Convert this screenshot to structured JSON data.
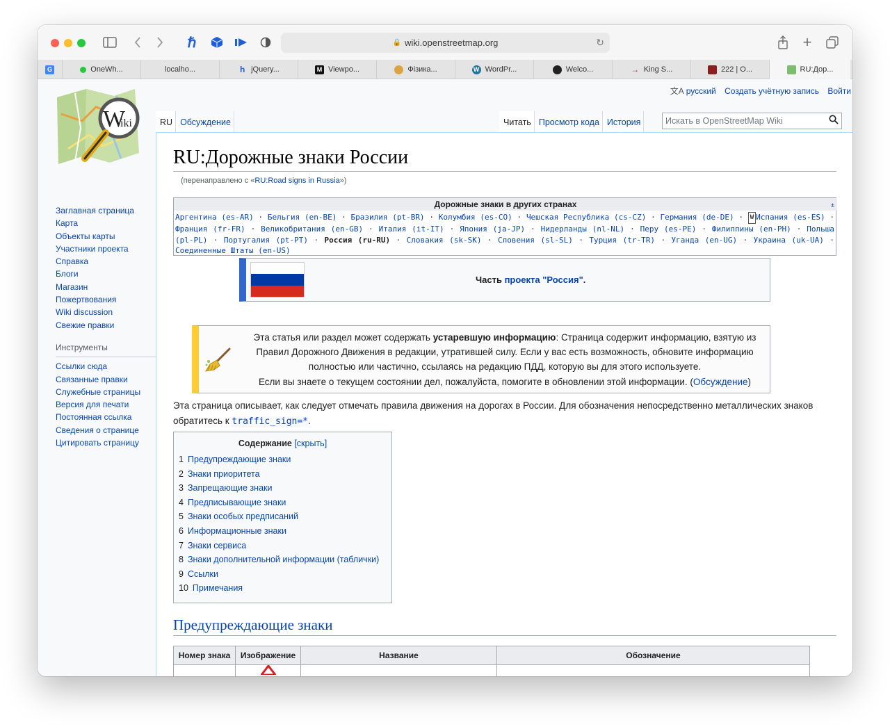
{
  "browser": {
    "url": "wiki.openstreetmap.org",
    "tabs": [
      {
        "label": "OneWh..."
      },
      {
        "label": "localho..."
      },
      {
        "label": "jQuery..."
      },
      {
        "label": "Viewpo..."
      },
      {
        "label": "Фізика..."
      },
      {
        "label": "WordPr..."
      },
      {
        "label": "Welco..."
      },
      {
        "label": "King S..."
      },
      {
        "label": "222 | O..."
      },
      {
        "label": "RU:Дор..."
      }
    ]
  },
  "logo": {
    "text": "W",
    "sub": "iki"
  },
  "personal": {
    "lang": "русский",
    "create": "Создать учётную запись",
    "login": "Войти"
  },
  "ctabs": {
    "ns": "RU",
    "talk": "Обсуждение",
    "read": "Читать",
    "source": "Просмотр кода",
    "history": "История"
  },
  "search": {
    "placeholder": "Искать в OpenStreetMap Wiki"
  },
  "sidebar": {
    "nav": [
      "Заглавная страница",
      "Карта",
      "Объекты карты",
      "Участники проекта",
      "Справка",
      "Блоги",
      "Магазин",
      "Пожертвования",
      "Wiki discussion",
      "Свежие правки"
    ],
    "tools_heading": "Инструменты",
    "tools": [
      "Ссылки сюда",
      "Связанные правки",
      "Служебные страницы",
      "Версия для печати",
      "Постоянная ссылка",
      "Сведения о странице",
      "Цитировать страницу"
    ]
  },
  "article": {
    "title": "RU:Дорожные знаки России",
    "redirect_pre": "(перенаправлено с «",
    "redirect_link": "RU:Road signs in Russia",
    "redirect_post": "»)",
    "navbox": {
      "title": "Дорожные знаки в других странах",
      "toggle": "±",
      "wiki_glyph": "W",
      "countries": [
        "Аргентина (es-AR)",
        "Бельгия (en-BE)",
        "Бразилия (pt-BR)",
        "Колумбия (es-CO)",
        "Чешская Республика (cs-CZ)",
        "Германия (de-DE)",
        "Испания (es-ES)",
        "Франция (fr-FR)",
        "Великобритания (en-GB)",
        "Италия (it-IT)",
        "Япония (ja-JP)",
        "Нидерланды (nl-NL)",
        "Перу (es-PE)",
        "Филиппины (en-PH)",
        "Польша (pl-PL)",
        "Португалия (pt-PT)",
        "Россия (ru-RU)",
        "Словакия (sk-SK)",
        "Словения (sl-SL)",
        "Турция (tr-TR)",
        "Уганда (en-UG)",
        "Украина (uk-UA)",
        "Соединенные Штаты (en-US)"
      ],
      "current": "Россия (ru-RU)"
    },
    "part": {
      "pre": "Часть ",
      "link": "проекта \"Россия\"",
      "post": "."
    },
    "outdated": {
      "pre": "Эта статья или раздел может содержать ",
      "bold": "устаревшую информацию",
      "mid": ": Страница содержит информацию, взятую из Правил Дорожного Движения в редакции, утратившей силу. Если у вас есть возможность, обновите информацию полностью или частично, ссылаясь на редакцию ПДД, которую вы для этого используете.",
      "line2": "Если вы знаете о текущем состоянии дел, пожалуйста, помогите в обновлении этой информации. (",
      "link": "Обсуждение",
      "close": ")"
    },
    "intro_pre": "Эта страница описывает, как следует отмечать правила движения на дорогах в России. Для обозначения непосредственно металлических знаков обратитесь к ",
    "intro_code": "traffic_sign=*",
    "intro_post": ".",
    "toc": {
      "title": "Содержание",
      "toggle": "[скрыть]",
      "items": [
        {
          "num": "1",
          "label": "Предупреждающие знаки"
        },
        {
          "num": "2",
          "label": "Знаки приоритета"
        },
        {
          "num": "3",
          "label": "Запрещающие знаки"
        },
        {
          "num": "4",
          "label": "Предписывающие знаки"
        },
        {
          "num": "5",
          "label": "Знаки особых предписаний"
        },
        {
          "num": "6",
          "label": "Информационные знаки"
        },
        {
          "num": "7",
          "label": "Знаки сервиса"
        },
        {
          "num": "8",
          "label": "Знаки дополнительной информации (таблички)"
        },
        {
          "num": "9",
          "label": "Ссылки"
        },
        {
          "num": "10",
          "label": "Примечания"
        }
      ]
    },
    "section1": "Предупреждающие знаки",
    "table": {
      "headers": [
        "Номер знака",
        "Изображение",
        "Название",
        "Обозначение"
      ]
    }
  },
  "colors": {
    "link": "#0645ad",
    "flag_white": "#ffffff",
    "flag_blue": "#0039a6",
    "flag_red": "#d52b1e"
  }
}
